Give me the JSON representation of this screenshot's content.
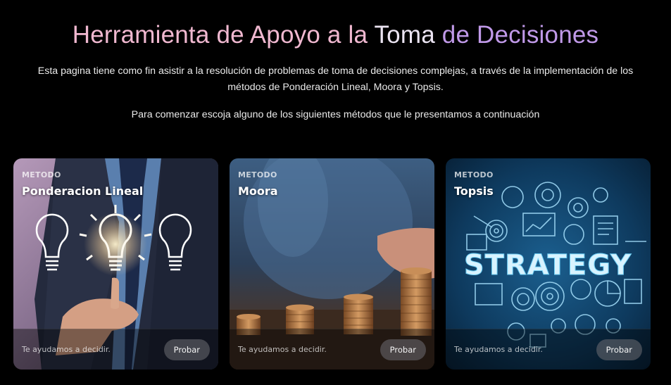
{
  "header": {
    "title_part1": "Herramienta de Apoyo a la ",
    "title_part2": "Toma ",
    "title_part3": "de Decisiones",
    "description_line1": "Esta pagina tiene como fin asistir a la resolución de problemas de toma de decisiones complejas, a través de la implementación de los",
    "description_line2": "métodos de Ponderación Lineal, Moora y Topsis.",
    "prompt": "Para comenzar escoja alguno de los siguientes métodos que le presentamos a continuación"
  },
  "colors": {
    "title_pink": "#f0b8d0",
    "title_light": "#ebe4f2",
    "title_purple": "#c099e8",
    "background": "#000000"
  },
  "cards": [
    {
      "kicker": "METODO",
      "name": "Ponderacion Lineal",
      "tagline": "Te ayudamos a decidir.",
      "button": "Probar",
      "image": "businessman-lightbulbs"
    },
    {
      "kicker": "METODO",
      "name": "Moora",
      "tagline": "Te ayudamos a decidir.",
      "button": "Probar",
      "image": "coin-stacks"
    },
    {
      "kicker": "METODO",
      "name": "Topsis",
      "tagline": "Te ayudamos a decidir.",
      "button": "Probar",
      "image": "strategy-icons",
      "image_text": "STRATEGY"
    }
  ]
}
